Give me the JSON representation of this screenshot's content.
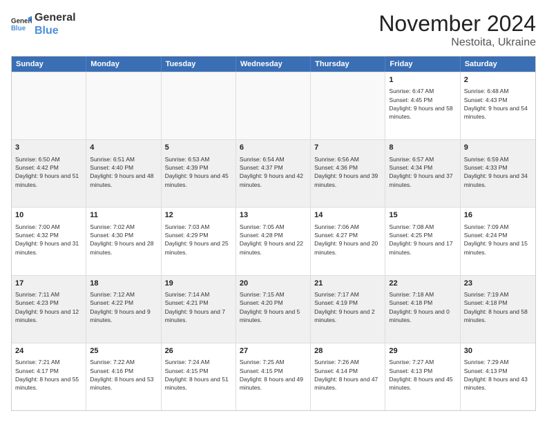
{
  "logo": {
    "line1": "General",
    "line2": "Blue"
  },
  "title": "November 2024",
  "subtitle": "Nestoita, Ukraine",
  "days": [
    "Sunday",
    "Monday",
    "Tuesday",
    "Wednesday",
    "Thursday",
    "Friday",
    "Saturday"
  ],
  "rows": [
    [
      {
        "day": "",
        "info": ""
      },
      {
        "day": "",
        "info": ""
      },
      {
        "day": "",
        "info": ""
      },
      {
        "day": "",
        "info": ""
      },
      {
        "day": "",
        "info": ""
      },
      {
        "day": "1",
        "info": "Sunrise: 6:47 AM\nSunset: 4:45 PM\nDaylight: 9 hours and 58 minutes."
      },
      {
        "day": "2",
        "info": "Sunrise: 6:48 AM\nSunset: 4:43 PM\nDaylight: 9 hours and 54 minutes."
      }
    ],
    [
      {
        "day": "3",
        "info": "Sunrise: 6:50 AM\nSunset: 4:42 PM\nDaylight: 9 hours and 51 minutes."
      },
      {
        "day": "4",
        "info": "Sunrise: 6:51 AM\nSunset: 4:40 PM\nDaylight: 9 hours and 48 minutes."
      },
      {
        "day": "5",
        "info": "Sunrise: 6:53 AM\nSunset: 4:39 PM\nDaylight: 9 hours and 45 minutes."
      },
      {
        "day": "6",
        "info": "Sunrise: 6:54 AM\nSunset: 4:37 PM\nDaylight: 9 hours and 42 minutes."
      },
      {
        "day": "7",
        "info": "Sunrise: 6:56 AM\nSunset: 4:36 PM\nDaylight: 9 hours and 39 minutes."
      },
      {
        "day": "8",
        "info": "Sunrise: 6:57 AM\nSunset: 4:34 PM\nDaylight: 9 hours and 37 minutes."
      },
      {
        "day": "9",
        "info": "Sunrise: 6:59 AM\nSunset: 4:33 PM\nDaylight: 9 hours and 34 minutes."
      }
    ],
    [
      {
        "day": "10",
        "info": "Sunrise: 7:00 AM\nSunset: 4:32 PM\nDaylight: 9 hours and 31 minutes."
      },
      {
        "day": "11",
        "info": "Sunrise: 7:02 AM\nSunset: 4:30 PM\nDaylight: 9 hours and 28 minutes."
      },
      {
        "day": "12",
        "info": "Sunrise: 7:03 AM\nSunset: 4:29 PM\nDaylight: 9 hours and 25 minutes."
      },
      {
        "day": "13",
        "info": "Sunrise: 7:05 AM\nSunset: 4:28 PM\nDaylight: 9 hours and 22 minutes."
      },
      {
        "day": "14",
        "info": "Sunrise: 7:06 AM\nSunset: 4:27 PM\nDaylight: 9 hours and 20 minutes."
      },
      {
        "day": "15",
        "info": "Sunrise: 7:08 AM\nSunset: 4:25 PM\nDaylight: 9 hours and 17 minutes."
      },
      {
        "day": "16",
        "info": "Sunrise: 7:09 AM\nSunset: 4:24 PM\nDaylight: 9 hours and 15 minutes."
      }
    ],
    [
      {
        "day": "17",
        "info": "Sunrise: 7:11 AM\nSunset: 4:23 PM\nDaylight: 9 hours and 12 minutes."
      },
      {
        "day": "18",
        "info": "Sunrise: 7:12 AM\nSunset: 4:22 PM\nDaylight: 9 hours and 9 minutes."
      },
      {
        "day": "19",
        "info": "Sunrise: 7:14 AM\nSunset: 4:21 PM\nDaylight: 9 hours and 7 minutes."
      },
      {
        "day": "20",
        "info": "Sunrise: 7:15 AM\nSunset: 4:20 PM\nDaylight: 9 hours and 5 minutes."
      },
      {
        "day": "21",
        "info": "Sunrise: 7:17 AM\nSunset: 4:19 PM\nDaylight: 9 hours and 2 minutes."
      },
      {
        "day": "22",
        "info": "Sunrise: 7:18 AM\nSunset: 4:18 PM\nDaylight: 9 hours and 0 minutes."
      },
      {
        "day": "23",
        "info": "Sunrise: 7:19 AM\nSunset: 4:18 PM\nDaylight: 8 hours and 58 minutes."
      }
    ],
    [
      {
        "day": "24",
        "info": "Sunrise: 7:21 AM\nSunset: 4:17 PM\nDaylight: 8 hours and 55 minutes."
      },
      {
        "day": "25",
        "info": "Sunrise: 7:22 AM\nSunset: 4:16 PM\nDaylight: 8 hours and 53 minutes."
      },
      {
        "day": "26",
        "info": "Sunrise: 7:24 AM\nSunset: 4:15 PM\nDaylight: 8 hours and 51 minutes."
      },
      {
        "day": "27",
        "info": "Sunrise: 7:25 AM\nSunset: 4:15 PM\nDaylight: 8 hours and 49 minutes."
      },
      {
        "day": "28",
        "info": "Sunrise: 7:26 AM\nSunset: 4:14 PM\nDaylight: 8 hours and 47 minutes."
      },
      {
        "day": "29",
        "info": "Sunrise: 7:27 AM\nSunset: 4:13 PM\nDaylight: 8 hours and 45 minutes."
      },
      {
        "day": "30",
        "info": "Sunrise: 7:29 AM\nSunset: 4:13 PM\nDaylight: 8 hours and 43 minutes."
      }
    ]
  ],
  "shaded_rows": [
    1,
    3
  ],
  "colors": {
    "header_bg": "#3a6eb5",
    "header_text": "#ffffff",
    "shaded_cell": "#f0f0f0",
    "normal_cell": "#ffffff"
  }
}
